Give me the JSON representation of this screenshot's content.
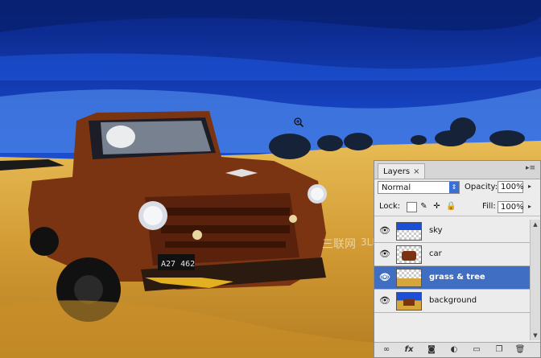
{
  "panel": {
    "tab_label": "Layers",
    "tab_close": "×",
    "blend_mode": "Normal",
    "opacity_label": "Opacity:",
    "opacity_value": "100%",
    "lock_label": "Lock:",
    "fill_label": "Fill:",
    "fill_value": "100%"
  },
  "layers": [
    {
      "name": "sky",
      "icon": "sky-thumb",
      "active": false
    },
    {
      "name": "car",
      "icon": "car-thumb",
      "active": false
    },
    {
      "name": "grass & tree",
      "icon": "grass-thumb",
      "active": true
    },
    {
      "name": "background",
      "icon": "background-thumb",
      "active": false
    }
  ],
  "footer_icons": [
    "link-icon",
    "fx-icon",
    "mask-icon",
    "adjustment-icon",
    "folder-icon",
    "new-layer-icon",
    "trash-icon"
  ],
  "colors": {
    "active_layer": "#3f6ec2",
    "sky_dark": "#0b2a8a",
    "sky_mid": "#1d4fd6",
    "sky_light": "#4f86e8",
    "grass": "#d7a63a",
    "truck_rust": "#8a3a14"
  }
}
